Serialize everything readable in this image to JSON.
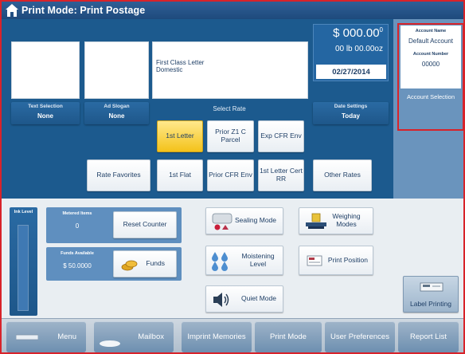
{
  "window": {
    "title": "Print Mode: Print Postage"
  },
  "address": {
    "line1": "First Class Letter",
    "line2": "Domestic"
  },
  "text_selection": {
    "caption": "Text Selection",
    "value": "None"
  },
  "ad_slogan": {
    "caption": "Ad Slogan",
    "value": "None"
  },
  "select_rate_label": "Select Rate",
  "rates_row1": [
    "1st Letter",
    "Prior Z1 C Parcel",
    "Exp CFR Env"
  ],
  "rates_row2": [
    "Rate Favorites",
    "1st Flat",
    "Prior CFR Env",
    "1st Letter Cert RR",
    "Other Rates"
  ],
  "postage": {
    "amount": "$ 000.00",
    "amount_super": "0",
    "weight": "00 lb 00.00oz",
    "date": "02/27/2014"
  },
  "date_settings": {
    "caption": "Date Settings",
    "value": "Today"
  },
  "account": {
    "name_label": "Account Name",
    "name": "Default Account",
    "number_label": "Account Number",
    "number": "00000",
    "selection_button": "Account Selection"
  },
  "ink": {
    "caption": "Ink Level",
    "level_percent": 100
  },
  "metered_items": {
    "caption": "Metered Items",
    "value": "0"
  },
  "reset_counter": "Reset Counter",
  "funds_available": {
    "caption": "Funds Available",
    "value": "$ 50.0000"
  },
  "funds_button": "Funds",
  "controls": {
    "sealing_mode": "Sealing Mode",
    "weighing_modes": "Weighing Modes",
    "moistening_level": "Moistening Level",
    "print_position": "Print Position",
    "quiet_mode": "Quiet Mode",
    "label_printing": "Label Printing"
  },
  "bottom_tabs": [
    "Menu",
    "Mailbox",
    "Imprint Memories",
    "Print Mode",
    "User Preferences",
    "Report List"
  ],
  "colors": {
    "frame_red": "#d8232a",
    "panel_blue": "#1c5a8e",
    "selected_yellow": "#f4c21a"
  }
}
